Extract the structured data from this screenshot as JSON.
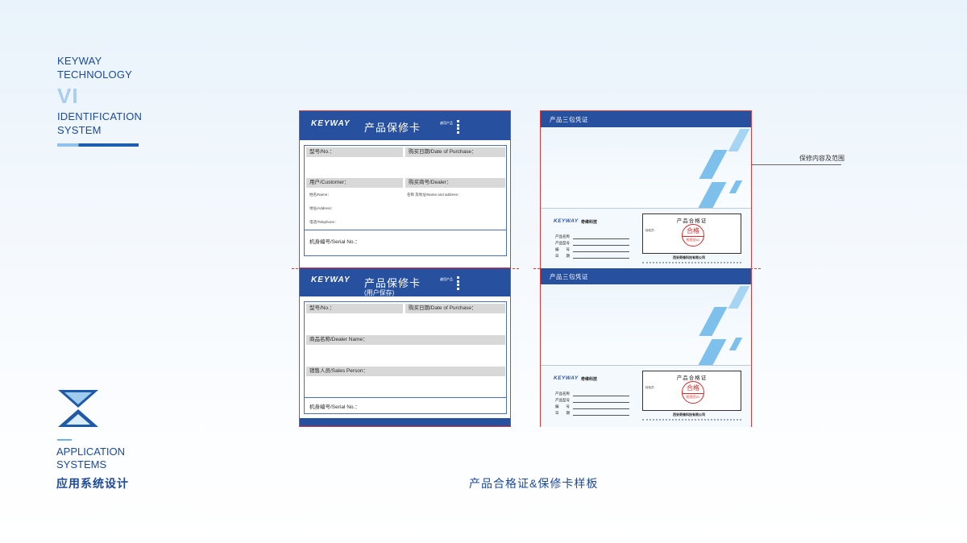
{
  "brand": {
    "line1": "KEYWAY",
    "line2": "TECHNOLOGY",
    "vi": "VI",
    "line3": "IDENTIFICATION",
    "line4": "SYSTEM"
  },
  "section": {
    "line1": "APPLICATION",
    "line2": "SYSTEMS",
    "cn_title": "应用系统设计"
  },
  "caption": "产品合格证&保修卡样板",
  "annotation": "保修内容及范围",
  "warranty_top": {
    "logo": "KEYWAY",
    "title": "产品保修卡",
    "small_label": "越用产品",
    "purchase_model": "型号/No.：",
    "purchase_date": "购买日期/Date of Purchase：",
    "customer": "用户/Customer：",
    "dealer": "购买商号/Dealer：",
    "name": "姓名/Name：",
    "address": "地址/Address：",
    "telephone": "电话/Telephone：",
    "dealer_name_addr": "名称 及地址/Name and address：",
    "serial": "机身编号/Serial No.："
  },
  "warranty_bottom": {
    "logo": "KEYWAY",
    "title": "产品保修卡",
    "subtitle": "(用户保存)",
    "small_label": "越用产品",
    "model": "型号/No.：",
    "purchase_date": "购买日期/Date of Purchase：",
    "dealer_name": "商品名称/Dealer Name：",
    "sales_person": "销售人员/Sales Person：",
    "serial": "机身编号/Serial No.："
  },
  "cert_card": {
    "header": "产品三包凭证",
    "logo": "KEYWAY",
    "logo_cn": "奇维科技",
    "fields": [
      "产品名称",
      "产品型号",
      "编　　号",
      "日　　期"
    ],
    "cert_title": "产品合格证",
    "inspector": "检验员：",
    "stamp_main": "合格",
    "stamp_sub": "检验员01",
    "company": "西安奇维科技有限公司"
  }
}
